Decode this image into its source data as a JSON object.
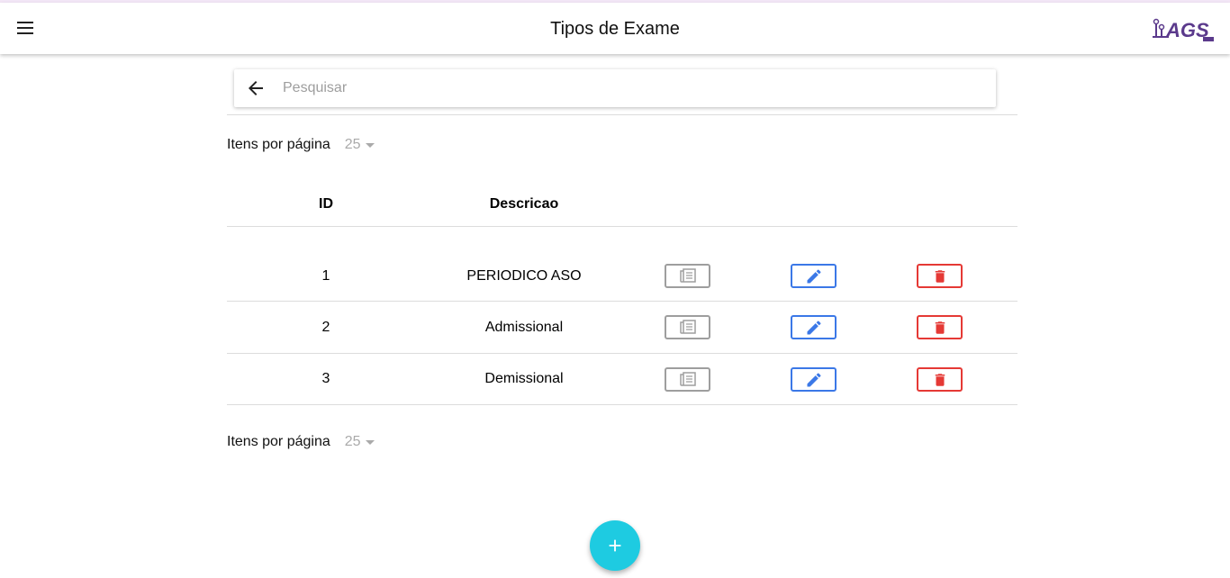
{
  "header": {
    "title": "Tipos de Exame",
    "logo_text": "AGS"
  },
  "search": {
    "placeholder": "Pesquisar",
    "value": ""
  },
  "pagination": {
    "items_per_page_label": "Itens por página",
    "items_per_page_value": "25"
  },
  "table": {
    "columns": [
      "ID",
      "Descricao"
    ],
    "rows": [
      {
        "id": "1",
        "descricao": "PERIODICO ASO"
      },
      {
        "id": "2",
        "descricao": "Admissional"
      },
      {
        "id": "3",
        "descricao": "Demissional"
      }
    ]
  },
  "icons": {
    "menu": "menu-icon",
    "back": "arrow-left-icon",
    "view": "newspaper-icon",
    "edit": "pencil-icon",
    "delete": "trash-icon",
    "add": "plus-icon"
  },
  "colors": {
    "edit": "#3b78e7",
    "delete": "#e53935",
    "view": "#9e9e9e",
    "fab": "#1ecbe1",
    "logo": "#5b3a8c"
  }
}
